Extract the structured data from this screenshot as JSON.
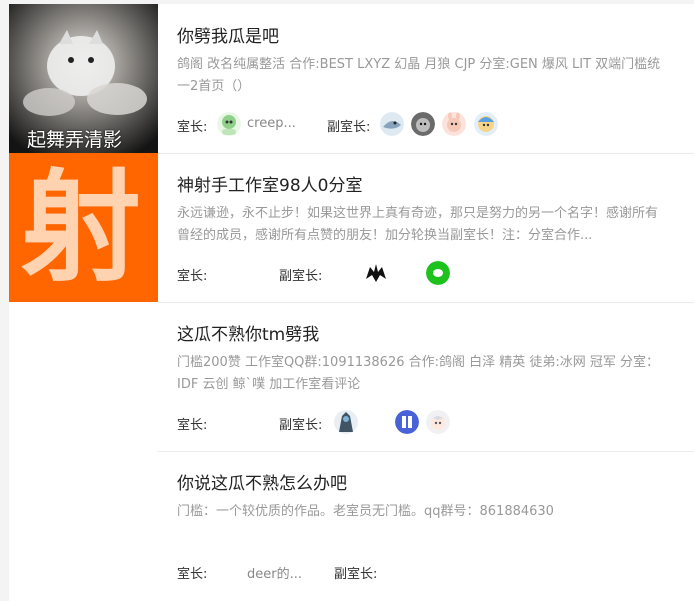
{
  "rooms": [
    {
      "thumb_caption": "起舞弄清影",
      "title": "你劈我瓜是吧",
      "description": "鸽阁 改名纯属整活 合作:BEST LXYZ 幻晶 月狼 CJP 分室:GEN 爆风 LIT 双端门槛统一2首页（）",
      "owner_label": "室长:",
      "owner_name": "creep...",
      "deputy_label": "副室长:",
      "owner_avatar_icon": "green-chibi-avatar",
      "deputy_avatar_icons": [
        "shark-avatar",
        "cat-photo-avatar",
        "pink-bunny-avatar",
        "blue-character-avatar"
      ]
    },
    {
      "thumb_caption": "射",
      "title": "神射手工作室98人0分室",
      "description": "永远谦逊，永不止步！如果这世界上真有奇迹，那只是努力的另一个名字！感谢所有曾经的成员，感谢所有点赞的朋友！加分轮换当副室长！注：分室合作...",
      "owner_label": "室长:",
      "deputy_label": "副室长:",
      "deputy_avatar_icons": [
        "black-wolf-avatar",
        "green-wechat-avatar"
      ],
      "colors": {
        "thumb_bg": "#ff6600",
        "thumb_glyph": "#ffd2b0"
      }
    },
    {
      "title": "这瓜不熟你tm劈我",
      "description": "门槛200赞 工作室QQ群:1091138626 合作:鸽阁 白泽 精英 徒弟:冰网 冠军 分室：IDF 云创 鲸`噗 加工作室看评论",
      "owner_label": "室长:",
      "deputy_label": "副室长:",
      "owner_avatar_icon": "dark-character-avatar",
      "deputy_avatar_icons": [
        "blue-logo-avatar",
        "white-hair-avatar"
      ]
    },
    {
      "title": "你说这瓜不熟怎么办吧",
      "description": "门槛：一个较优质的作品。老室员无门槛。qq群号：861884630",
      "owner_label": "室长:",
      "owner_name": "deer的...",
      "deputy_label": "副室长:"
    }
  ]
}
